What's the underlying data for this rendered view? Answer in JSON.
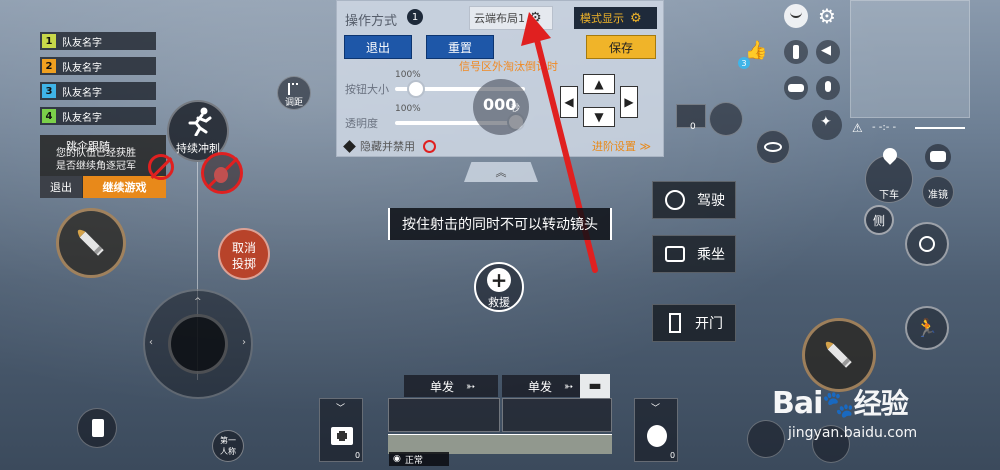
{
  "team": [
    {
      "num": "1",
      "name": "队友名字",
      "color": "#c8d84a"
    },
    {
      "num": "2",
      "name": "队友名字",
      "color": "#f0a020"
    },
    {
      "num": "3",
      "name": "队友名字",
      "color": "#3fb4e8"
    },
    {
      "num": "4",
      "name": "队友名字",
      "color": "#7bd04a"
    }
  ],
  "jump_prompt": {
    "title": "跳伞跟随",
    "line1": "您的队伍已经获胜",
    "line2": "是否继续角逐冠军",
    "exit": "退出",
    "continue": "继续游戏"
  },
  "panel": {
    "title": "操作方式",
    "mode_num": "1",
    "layout_name": "云端布局1",
    "mode_display": "模式显示",
    "exit": "退出",
    "reset": "重置",
    "save": "保存",
    "signal_notice": "信号区外淘汰倒计时",
    "btn_size_label": "按钮大小",
    "btn_size_pct": "100%",
    "opacity_label": "透明度",
    "opacity_pct": "100%",
    "btn_size_value": 0.16,
    "opacity_value": 1.0,
    "preview_text": "000",
    "preview_unit": "秒",
    "hide_disable": "隐藏并禁用",
    "advanced": "进阶设置"
  },
  "sprint_label": "持续冲刺",
  "cancel_throw": [
    "取消",
    "投掷"
  ],
  "ranging_label": "调距",
  "tooltip": "按住射击的同时不可以转动镜头",
  "rescue_label": "救援",
  "actions": {
    "drive": "驾驶",
    "ride": "乘坐",
    "open_door": "开门"
  },
  "right": {
    "badge_count": "3",
    "getoff": "下车",
    "aim": "准镜",
    "side": "侧",
    "minimap_dist": "- -:- -"
  },
  "fire_modes": [
    "单发",
    "单发"
  ],
  "ammo_counts": [
    "0",
    "0",
    "0"
  ],
  "stance": "正常",
  "first_person": [
    "第一",
    "人称"
  ],
  "watermark": {
    "brand": "Bai",
    "jingyan": "经验",
    "url": "jingyan.baidu.com"
  },
  "colors": {
    "accent_blue": "#1e57a8",
    "save_yellow": "#f0b429",
    "orange": "#e8891a",
    "red": "#e02020",
    "notice_orange": "#f08a24"
  }
}
